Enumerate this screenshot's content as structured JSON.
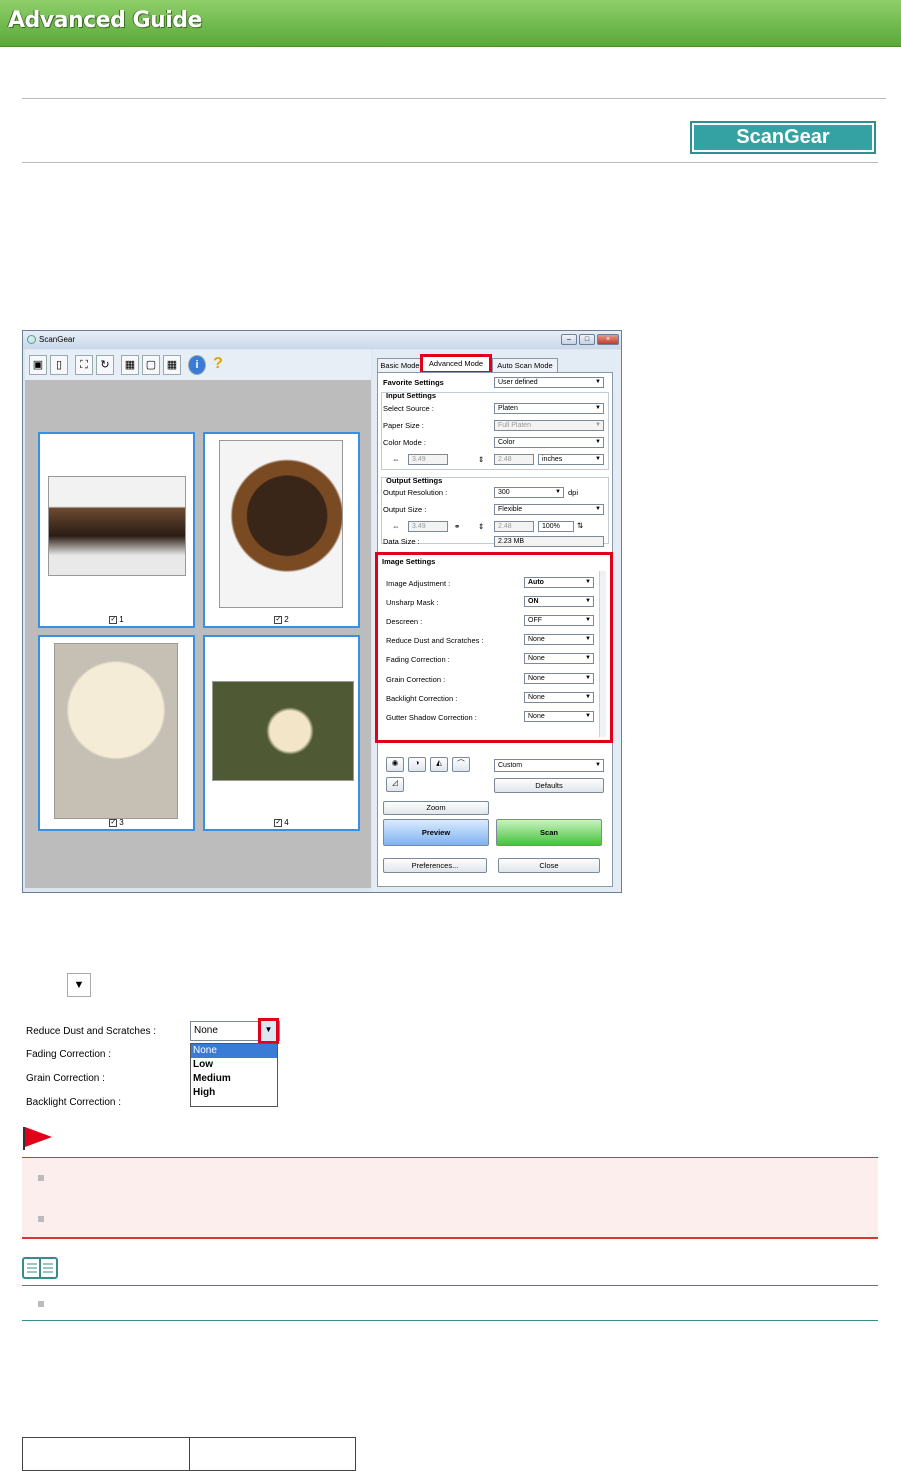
{
  "header": {
    "title": "Advanced Guide"
  },
  "badge": {
    "label": "ScanGear"
  },
  "scangear": {
    "window_title": "ScanGear",
    "tabs": [
      "Basic Mode",
      "Advanced Mode",
      "Auto Scan Mode"
    ],
    "thumbnails": [
      {
        "number": "1",
        "checked": true
      },
      {
        "number": "2",
        "checked": true
      },
      {
        "number": "3",
        "checked": true
      },
      {
        "number": "4",
        "checked": true
      }
    ],
    "favorite_settings": {
      "label": "Favorite Settings",
      "value": "User defined"
    },
    "input_settings": {
      "heading": "Input Settings",
      "select_source": {
        "label": "Select Source :",
        "value": "Platen"
      },
      "paper_size": {
        "label": "Paper Size :",
        "value": "Full Platen"
      },
      "color_mode": {
        "label": "Color Mode :",
        "value": "Color"
      },
      "width": "3.49",
      "height": "2.48",
      "unit": "inches"
    },
    "output_settings": {
      "heading": "Output Settings",
      "resolution": {
        "label": "Output Resolution :",
        "value": "300",
        "unit": "dpi"
      },
      "size": {
        "label": "Output Size :",
        "value": "Flexible"
      },
      "width": "3.49",
      "height": "2.48",
      "scale": "100%",
      "data_size": {
        "label": "Data Size :",
        "value": "2.23 MB"
      }
    },
    "image_settings": {
      "heading": "Image Settings",
      "rows": [
        {
          "label": "Image Adjustment :",
          "value": "Auto"
        },
        {
          "label": "Unsharp Mask :",
          "value": "ON"
        },
        {
          "label": "Descreen :",
          "value": "OFF"
        },
        {
          "label": "Reduce Dust and Scratches :",
          "value": "None"
        },
        {
          "label": "Fading Correction :",
          "value": "None"
        },
        {
          "label": "Grain Correction :",
          "value": "None"
        },
        {
          "label": "Backlight Correction :",
          "value": "None"
        },
        {
          "label": "Gutter Shadow Correction :",
          "value": "None"
        }
      ]
    },
    "tone": {
      "preset": "Custom",
      "defaults_button": "Defaults"
    },
    "buttons": {
      "zoom": "Zoom",
      "preview": "Preview",
      "scan": "Scan",
      "preferences": "Preferences...",
      "close": "Close"
    }
  },
  "dropdown_example": {
    "rows": [
      {
        "label": "Reduce Dust and Scratches :"
      },
      {
        "label": "Fading Correction :"
      },
      {
        "label": "Grain Correction :"
      },
      {
        "label": "Backlight Correction :"
      }
    ],
    "selected": "None",
    "options": [
      "None",
      "Low",
      "Medium",
      "High"
    ]
  },
  "colors": {
    "banner": "#5aa83a",
    "badge": "#34a2a2",
    "highlight": "#e0001a",
    "important_bg": "#fdeeee",
    "note_rule": "#3a8c8c"
  }
}
